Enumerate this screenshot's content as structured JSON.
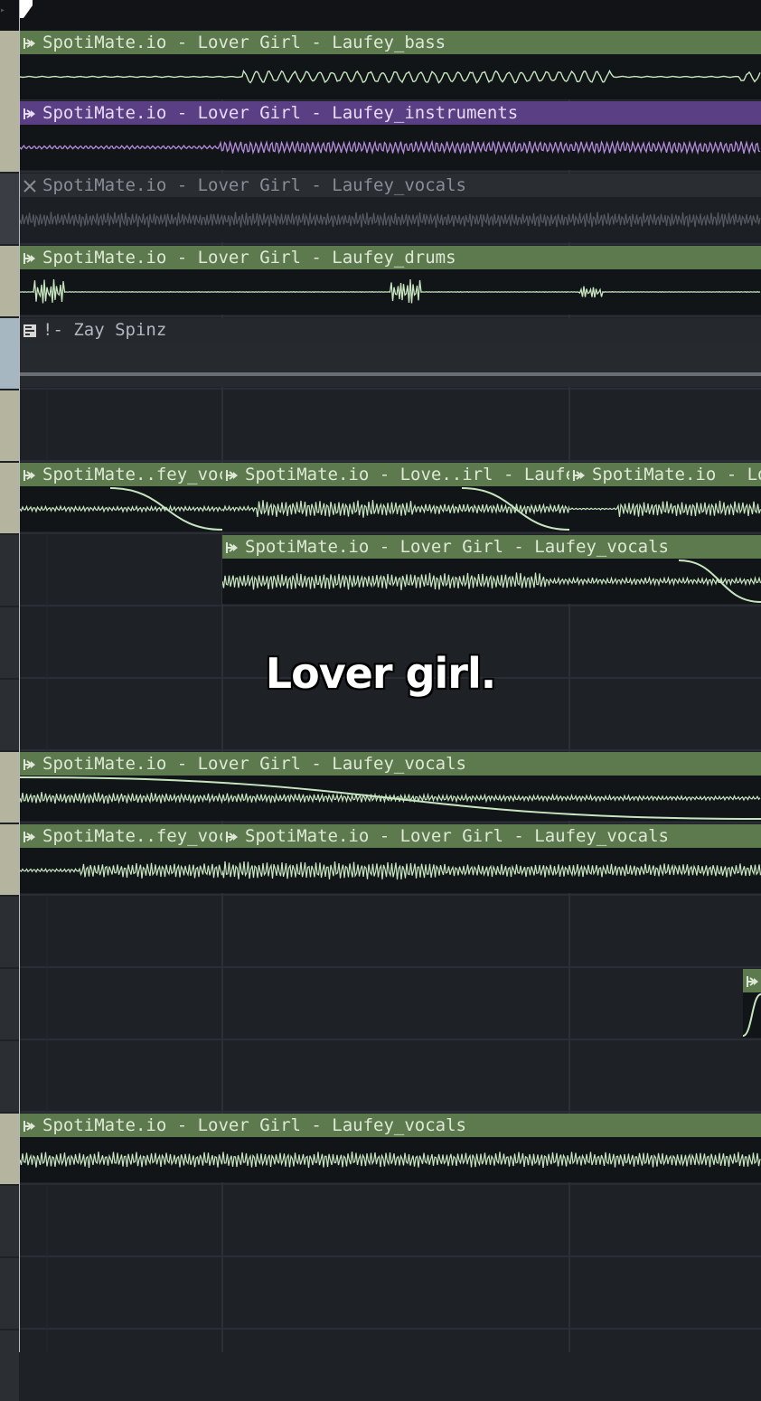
{
  "colors": {
    "background": "#1e2126",
    "clip_green_header": "#5c7a4e",
    "clip_green_text": "#dfe8d6",
    "clip_purple_header": "#5b3f85",
    "wave_green": "#c7e6c0",
    "wave_purple": "#b48ddc",
    "muted_text": "#8a8e94",
    "caption": "#ffffff"
  },
  "caption": "Lover girl.",
  "clips": [
    {
      "id": "bass",
      "title": "SpotiMate.io - Lover Girl - Laufey_bass",
      "state": "normal",
      "color": "green",
      "icon": "sample-arrow-icon"
    },
    {
      "id": "instruments",
      "title": "SpotiMate.io - Lover Girl - Laufey_instruments",
      "state": "normal",
      "color": "purple",
      "icon": "sample-arrow-icon"
    },
    {
      "id": "vocals-muted",
      "title": "SpotiMate.io - Lover Girl - Laufey_vocals",
      "state": "muted",
      "color": "grey",
      "icon": "mute-x-icon"
    },
    {
      "id": "drums",
      "title": "SpotiMate.io - Lover Girl - Laufey_drums",
      "state": "normal",
      "color": "green",
      "icon": "sample-arrow-icon"
    },
    {
      "id": "pattern",
      "title": "!- Zay Spinz",
      "state": "pattern",
      "color": "grey",
      "icon": "pattern-icon"
    },
    {
      "id": "v1a",
      "title": "SpotiMate..fey_vocals",
      "state": "normal",
      "color": "green",
      "icon": "sample-arrow-icon"
    },
    {
      "id": "v1b",
      "title": "SpotiMate.io - Love..irl - Laufey_vocals",
      "state": "normal",
      "color": "green",
      "icon": "sample-arrow-icon"
    },
    {
      "id": "v1c",
      "title": "SpotiMate.io - Love..",
      "state": "normal",
      "color": "green",
      "icon": "sample-arrow-icon"
    },
    {
      "id": "v2",
      "title": "SpotiMate.io - Lover Girl - Laufey_vocals",
      "state": "normal",
      "color": "green",
      "icon": "sample-arrow-icon"
    },
    {
      "id": "v3",
      "title": "SpotiMate.io - Lover Girl - Laufey_vocals",
      "state": "normal",
      "color": "green",
      "icon": "sample-arrow-icon"
    },
    {
      "id": "v4a",
      "title": "SpotiMate..fey_vocals",
      "state": "normal",
      "color": "green",
      "icon": "sample-arrow-icon"
    },
    {
      "id": "v4b",
      "title": "SpotiMate.io - Lover Girl - Laufey_vocals",
      "state": "normal",
      "color": "green",
      "icon": "sample-arrow-icon"
    },
    {
      "id": "v5",
      "title": "",
      "state": "normal",
      "color": "green",
      "icon": "sample-arrow-icon"
    },
    {
      "id": "v6",
      "title": "SpotiMate.io - Lover Girl - Laufey_vocals",
      "state": "normal",
      "color": "green",
      "icon": "sample-arrow-icon"
    }
  ]
}
